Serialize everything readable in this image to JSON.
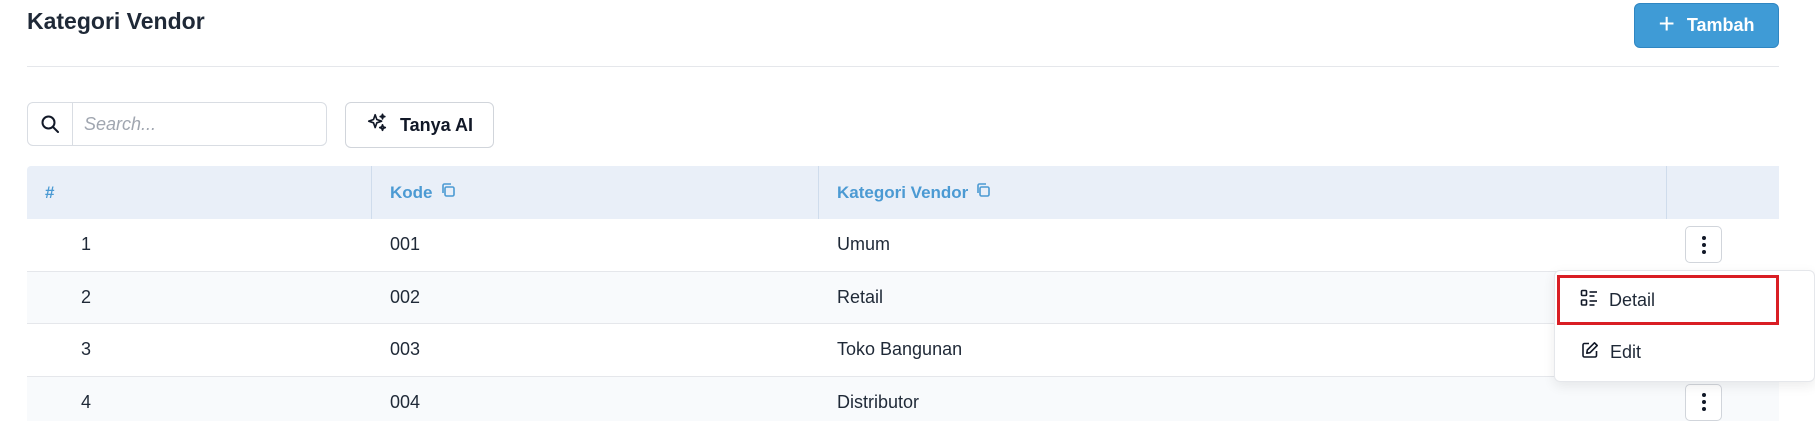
{
  "header": {
    "title": "Kategori Vendor",
    "add_label": "Tambah"
  },
  "toolbar": {
    "search_placeholder": "Search...",
    "ai_label": "Tanya AI"
  },
  "table": {
    "columns": [
      "#",
      "Kode",
      "Kategori Vendor"
    ],
    "rows": [
      {
        "no": "1",
        "code": "001",
        "name": "Umum"
      },
      {
        "no": "2",
        "code": "002",
        "name": "Retail"
      },
      {
        "no": "3",
        "code": "003",
        "name": "Toko Bangunan"
      },
      {
        "no": "4",
        "code": "004",
        "name": "Distributor"
      }
    ]
  },
  "row_menu": {
    "items": [
      "Detail",
      "Edit"
    ],
    "highlight_color": "#d91e24"
  },
  "colors": {
    "accent": "#3f9bd6",
    "header_bg": "#e9eff8",
    "header_text": "#4b9ad3"
  }
}
